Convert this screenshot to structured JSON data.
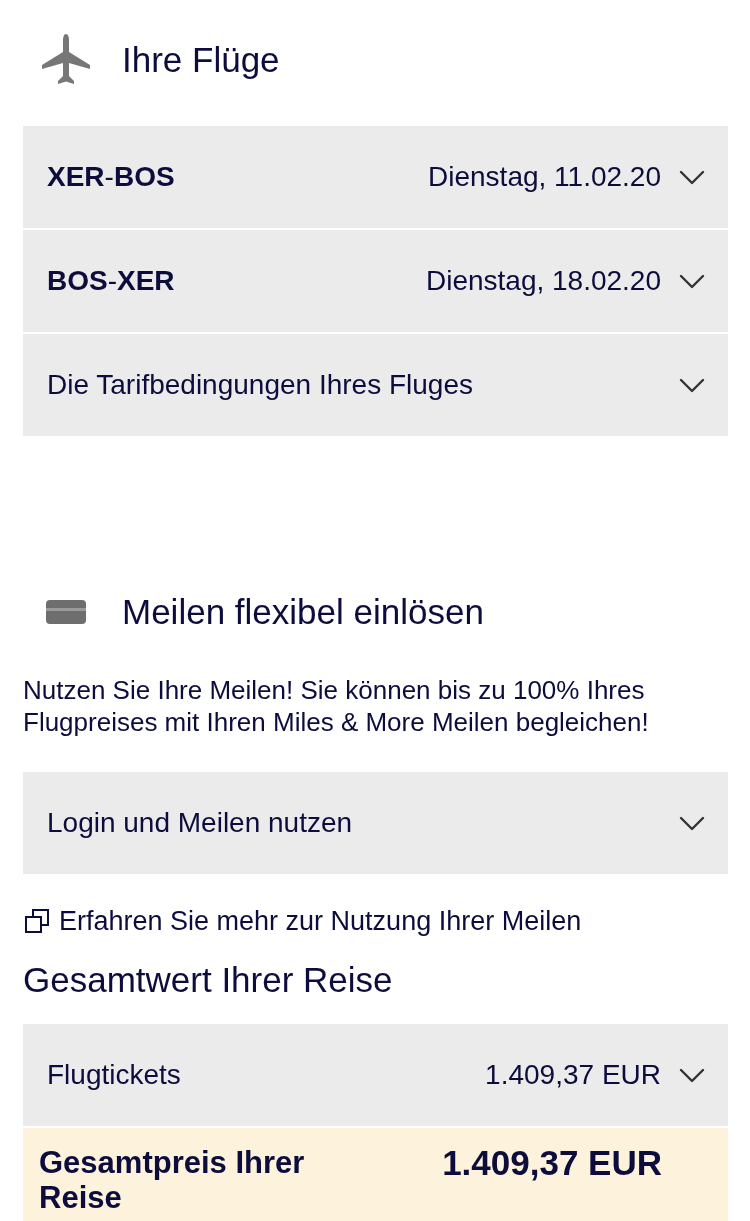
{
  "flights": {
    "title": "Ihre Flüge",
    "rows": [
      {
        "kind": "route",
        "label": "**XER**-**BOS**",
        "value": "Dienstag, 11.02.20",
        "expanded": false
      },
      {
        "kind": "route",
        "label": "**BOS**-**XER**",
        "value": "Dienstag, 18.02.20",
        "expanded": false
      },
      {
        "kind": "plain",
        "label": "Die Tarifbedingungen Ihres Fluges",
        "expanded": false
      }
    ]
  },
  "miles": {
    "title": "Meilen flexibel einlösen",
    "intro": "Nutzen Sie Ihre Meilen! Sie können bis zu 100% Ihres Flugpreises mit Ihren Miles & More Meilen begleichen!",
    "rows": [
      {
        "kind": "plain",
        "label": "Login und Meilen nutzen",
        "expanded": false
      }
    ],
    "link": "Erfahren Sie mehr zur Nutzung Ihrer Meilen"
  },
  "total": {
    "title": "Gesamtwert Ihrer Reise",
    "rows": [
      {
        "kind": "price",
        "label": "Flugtickets",
        "value": "1.409,37 EUR",
        "expanded": false
      }
    ],
    "grand_total": {
      "label": "Gesamtpreis Ihrer Reise",
      "value": "1.409,37 EUR"
    }
  }
}
